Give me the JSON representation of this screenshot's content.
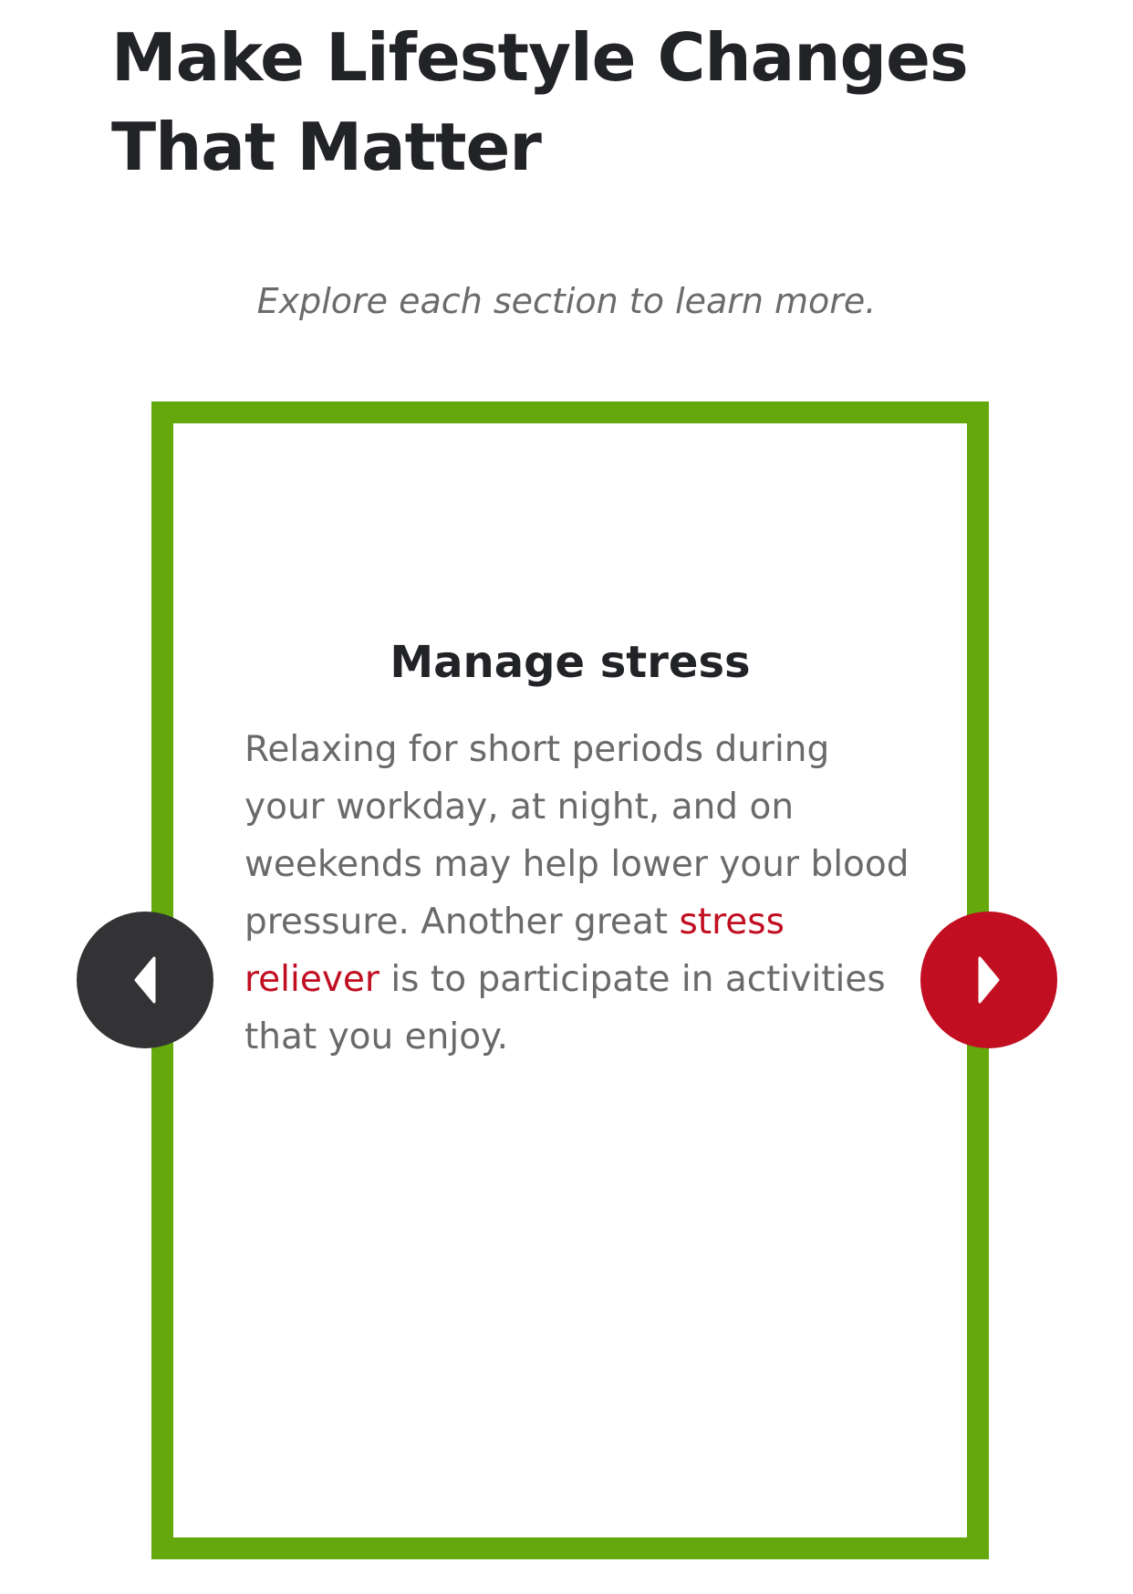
{
  "header": {
    "title": "Make Lifestyle Changes That Matter",
    "subtitle": "Explore each section to learn more."
  },
  "carousel": {
    "card": {
      "heading": "Manage stress",
      "body_before": "Relaxing for short periods during your workday, at night, and on weekends may help lower your blood pressure. Another great ",
      "link_text": "stress reliever",
      "body_after": " is to participate in activities that you enjoy."
    },
    "prev_icon": "chevron-left-icon",
    "next_icon": "chevron-right-icon",
    "colors": {
      "card_border": "#64a80c",
      "prev_button": "#333335",
      "next_button": "#c10e21",
      "link": "#c10e21"
    }
  }
}
